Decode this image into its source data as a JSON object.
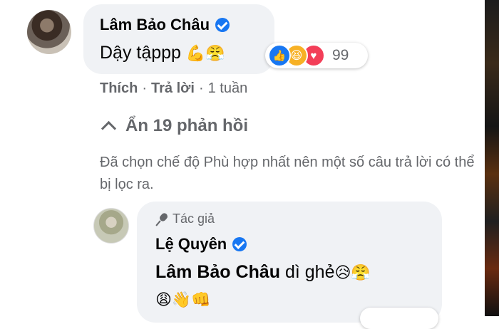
{
  "comment": {
    "author": "Lâm Bảo Châu",
    "text": "Dậy tậppp",
    "emojis": "💪😤",
    "reactions": {
      "icons": [
        "like-icon",
        "haha-icon",
        "love-icon"
      ],
      "count": "99"
    },
    "actions": {
      "like_label": "Thích",
      "separator": "·",
      "reply_label": "Trả lời",
      "time": "1 tuần"
    }
  },
  "replies_toggle": {
    "label": "Ẩn 19 phản hồi"
  },
  "filter_note": "Đã chọn chế độ Phù hợp nhất nên một số câu trả lời có thể bị lọc ra.",
  "reply": {
    "badge": "Tác giả",
    "author": "Lệ Quyên",
    "mention": "Lâm Bảo Châu",
    "text": "dì ghẻ",
    "emojis_line1": "😥😤",
    "emojis_line2": "😩👋👊"
  },
  "colors": {
    "bubble": "#f0f2f5",
    "secondary_text": "#65676b",
    "verified": "#1877f2"
  }
}
